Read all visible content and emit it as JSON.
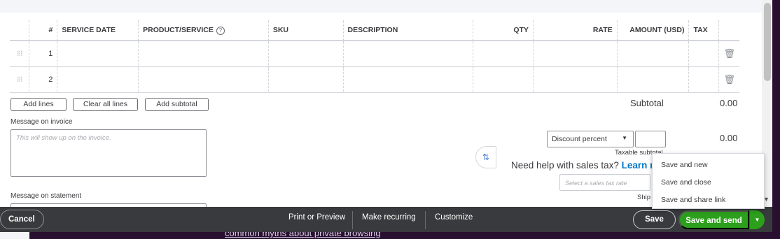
{
  "table": {
    "headers": [
      "",
      "#",
      "SERVICE DATE",
      "PRODUCT/SERVICE",
      "SKU",
      "DESCRIPTION",
      "QTY",
      "RATE",
      "AMOUNT (USD)",
      "TAX",
      ""
    ],
    "rows": [
      {
        "num": "1"
      },
      {
        "num": "2"
      }
    ]
  },
  "icons": {
    "drag": "drag-handle-icon",
    "delete": "trash-icon",
    "help": "help-circle-icon",
    "tax": "sales-tax-icon"
  },
  "line_buttons": {
    "add_lines": "Add lines",
    "clear_all_lines": "Clear all lines",
    "add_subtotal": "Add subtotal"
  },
  "totals": {
    "subtotal_label": "Subtotal",
    "subtotal_value": "0.00",
    "discount_type": "Discount percent",
    "discount_value": "0.00",
    "taxable_subtotal_label": "Taxable subtotal",
    "tax_rate_placeholder": "Select a sales tax rate",
    "shipping_label": "Ship"
  },
  "messages": {
    "invoice_label": "Message on invoice",
    "invoice_placeholder": "This will show up on the invoice.",
    "statement_label": "Message on statement"
  },
  "tax_help": {
    "text": "Need help with sales tax?",
    "link": "Learn m"
  },
  "save_menu": {
    "items": [
      "Save and new",
      "Save and close",
      "Save and share link"
    ]
  },
  "footer": {
    "cancel": "Cancel",
    "print_preview": "Print or Preview",
    "make_recurring": "Make recurring",
    "customize": "Customize",
    "save": "Save",
    "save_and_send": "Save and send"
  },
  "background": {
    "link_text": "common myths about private browsing"
  },
  "colors": {
    "primary_green": "#2ca01c",
    "footer_bg": "#393a3d",
    "link_blue": "#0077c5"
  }
}
